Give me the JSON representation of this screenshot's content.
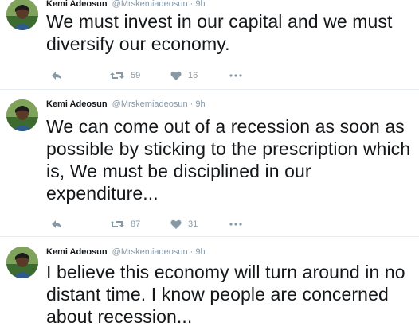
{
  "tweets": [
    {
      "name": "Kemi Adeosun",
      "handle": "@Mrskemiadeosun",
      "separator": "·",
      "time": "9h",
      "text": "We must invest in our capital and we must diversify our economy.",
      "retweets": "59",
      "likes": "16"
    },
    {
      "name": "Kemi Adeosun",
      "handle": "@Mrskemiadeosun",
      "separator": "·",
      "time": "9h",
      "text": "We can come out of a recession as soon as possible by sticking to the prescription which is, We must be disciplined in our expenditure...",
      "retweets": "87",
      "likes": "31"
    },
    {
      "name": "Kemi Adeosun",
      "handle": "@Mrskemiadeosun",
      "separator": "·",
      "time": "9h",
      "text": "I believe this economy will turn around in no distant time. I know people are concerned about recession..."
    }
  ],
  "icons": {
    "reply": "reply-icon",
    "retweet": "retweet-icon",
    "like": "heart-icon",
    "more": "more-icon"
  },
  "colors": {
    "text": "#14171a",
    "muted": "#8899a6",
    "divider": "#e6ecf0"
  }
}
